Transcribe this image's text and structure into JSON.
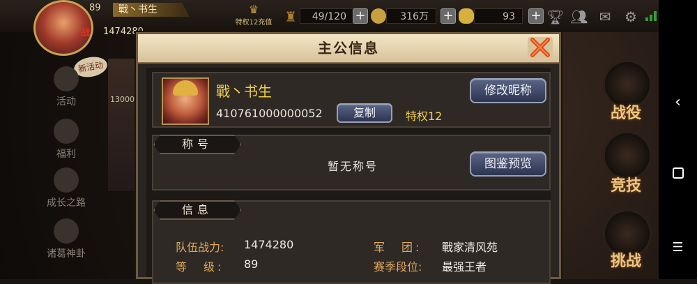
{
  "top_bar": {
    "level": "89",
    "player_name": "戰丶书生",
    "power": "1474280",
    "vip_label": "特权12充值",
    "stamina": "49/120",
    "gold": "316万",
    "ingot": "93"
  },
  "left_menu": {
    "new_activity": "新活动",
    "items": [
      {
        "label": "活动"
      },
      {
        "label": "福利"
      },
      {
        "label": "成长之路"
      },
      {
        "label": "诸葛神卦"
      }
    ]
  },
  "background": {
    "card_number": "13000"
  },
  "right_menu": {
    "items": [
      {
        "label": "战役"
      },
      {
        "label": "竞技"
      },
      {
        "label": "挑战"
      }
    ]
  },
  "dialog": {
    "title": "主公信息",
    "profile": {
      "name": "戰丶书生",
      "id": "410761000000052",
      "copy_label": "复制",
      "vip": "特权12",
      "rename_label": "修改昵称"
    },
    "title_section": {
      "header": "称号",
      "empty_text": "暂无称号",
      "preview_label": "图鉴预览"
    },
    "info_section": {
      "header": "信息",
      "rows": [
        {
          "label": "队伍战力:",
          "value": "1474280"
        },
        {
          "label": "等　级:",
          "value": "89"
        },
        {
          "label": "军　团:",
          "value": "戰家清风苑"
        },
        {
          "label": "赛季段位:",
          "value": "最强王者"
        }
      ]
    }
  },
  "colors": {
    "name_gold": "#f2d04a",
    "label_orange": "#e0a860",
    "header_beige": "#f4e6c4",
    "button_blue": "#3c4666"
  }
}
